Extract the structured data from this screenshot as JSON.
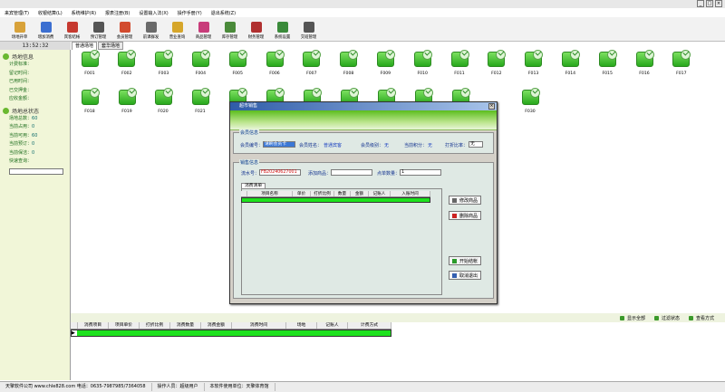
{
  "menubar": [
    "来宾管理(T)",
    "收银结算(L)",
    "系统维护(R)",
    "报表注册(B)",
    "设置输入法(X)",
    "操作手册(Y)",
    "退出系统(Z)"
  ],
  "toolbar": [
    {
      "label": "场地开单",
      "color": "#d8a23a"
    },
    {
      "label": "增加消费",
      "color": "#3c6fd1"
    },
    {
      "label": "宾客结帐",
      "color": "#c6392f"
    },
    {
      "label": "预订管理",
      "color": "#555555"
    },
    {
      "label": "会员管理",
      "color": "#d24b2e"
    },
    {
      "label": "前课群发",
      "color": "#6a6a6a"
    },
    {
      "label": "营业查询",
      "color": "#d6a62b"
    },
    {
      "label": "商品管理",
      "color": "#c83c7a"
    },
    {
      "label": "库存管理",
      "color": "#4a8a3a"
    },
    {
      "label": "财务管理",
      "color": "#b03030"
    },
    {
      "label": "系统设置",
      "color": "#3a8a3a"
    },
    {
      "label": "交班管理",
      "color": "#555555"
    }
  ],
  "clock": "13:52:32",
  "left": {
    "section1": "场地信息",
    "info_rows": [
      "计费标准：",
      "留记时间：",
      "已用时间：",
      "已交押金：",
      "应收金额："
    ],
    "section2": "场地总状态",
    "status_rows": [
      {
        "label": "场地总数：",
        "value": "60"
      },
      {
        "label": "当前占用：",
        "value": "0"
      },
      {
        "label": "当前可用：",
        "value": "60"
      },
      {
        "label": "当前预订：",
        "value": "0"
      },
      {
        "label": "当前保洁：",
        "value": "0"
      }
    ],
    "quick_search_label": "快速查询："
  },
  "page_tabs": [
    "普通场地",
    "套华场地"
  ],
  "rooms_row1": [
    "F001",
    "F002",
    "F003",
    "F004",
    "F005",
    "F006",
    "F007",
    "F008",
    "F009",
    "F010",
    "F011",
    "F012",
    "F013",
    "F014",
    "F015",
    "F016",
    "F017"
  ],
  "rooms_row2": [
    "F018",
    "F019",
    "F020",
    "F021",
    "F030"
  ],
  "dialog": {
    "title": "超市销售",
    "group1": "会员信息",
    "member_no_label": "会员编号：",
    "member_no_value": "请刷会员卡",
    "member_name_label": "会员姓名：",
    "member_name_value": "普通宾客",
    "member_level_label": "会员级别：",
    "member_level_value": "无",
    "points_label": "当前积分：",
    "points_value": "无",
    "discount_label": "打折比率：",
    "discount_value": "无",
    "group2": "销售信息",
    "serial_label": "流水号：",
    "serial_value": "FB20240627001",
    "add_label": "添加商品：",
    "qty_label": "点单数量：",
    "qty_value": "1",
    "list_tab": "消费清单",
    "columns": [
      "项目名称",
      "单价",
      "打折比例",
      "数量",
      "金额",
      "记账人",
      "入账时间"
    ],
    "btn_modify": "修改商品",
    "btn_delete": "删除商品",
    "btn_start": "开始结帐",
    "btn_cancel": "取消退出"
  },
  "bottom": {
    "tools": [
      "显示全部",
      "过滤状态",
      "查看方式"
    ],
    "columns": [
      "消费项目",
      "项目单价",
      "打折比例",
      "消费数量",
      "消费金额",
      "消费时间",
      "场地",
      "记账人",
      "计费方式"
    ]
  },
  "status": [
    "天擎软件公司 www.chle828.com 电话：0635-7987985/7364058",
    "操作人员：超级用户",
    "本软件使用单位：天擎体育馆"
  ]
}
